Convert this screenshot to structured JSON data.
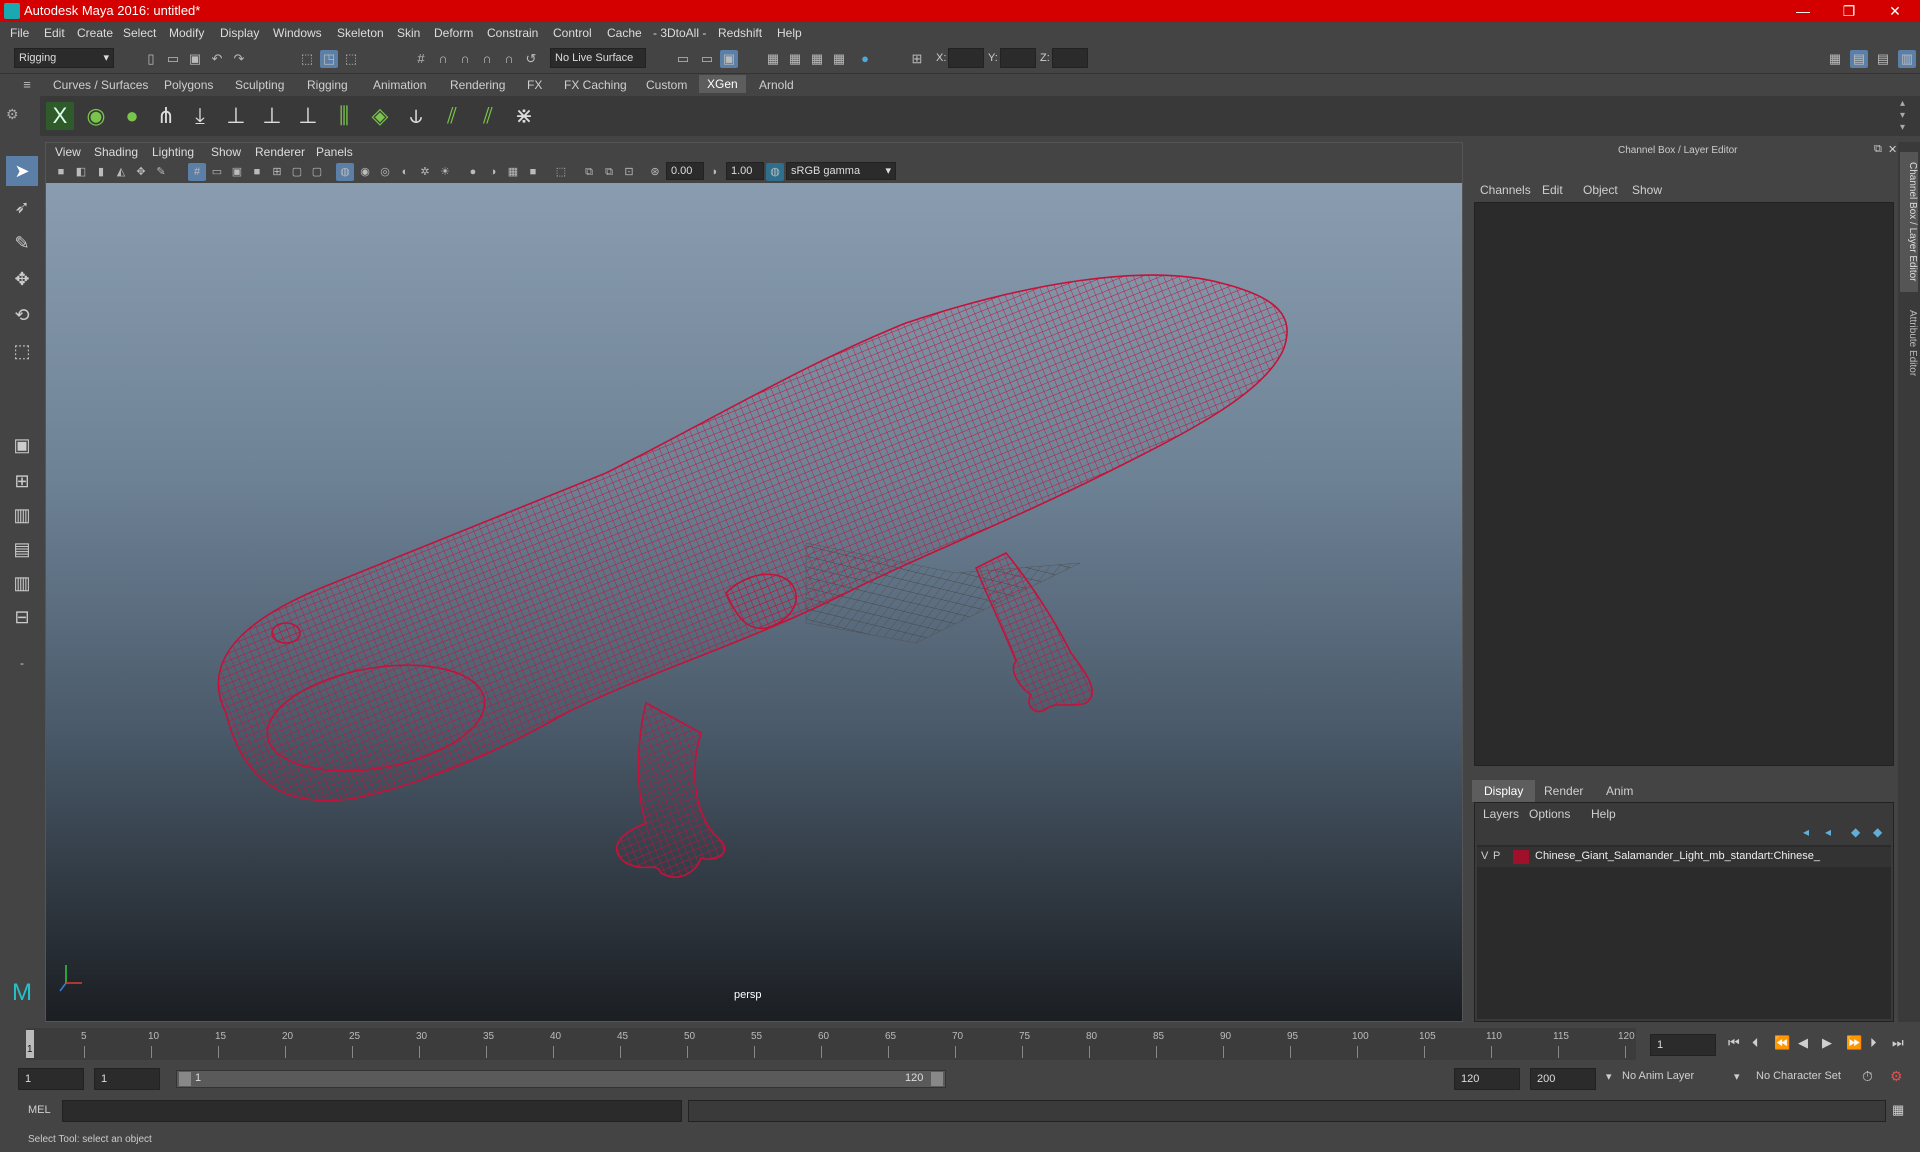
{
  "window": {
    "title": "Autodesk Maya 2016: untitled*",
    "minimize": "—",
    "restore": "❐",
    "close": "✕"
  },
  "menu": [
    "File",
    "Edit",
    "Create",
    "Select",
    "Modify",
    "Display",
    "Windows",
    "Skeleton",
    "Skin",
    "Deform",
    "Constrain",
    "Control",
    "Cache",
    "- 3DtoAll -",
    "Redshift",
    "Help"
  ],
  "statusline": {
    "menuset": "Rigging",
    "live_surface": "No Live Surface",
    "x_label": "X:",
    "y_label": "Y:",
    "z_label": "Z:"
  },
  "shelf_tabs": [
    "Curves / Surfaces",
    "Polygons",
    "Sculpting",
    "Rigging",
    "Animation",
    "Rendering",
    "FX",
    "FX Caching",
    "Custom",
    "XGen",
    "Arnold"
  ],
  "active_shelf": "XGen",
  "panel_menu": [
    "View",
    "Shading",
    "Lighting",
    "Show",
    "Renderer",
    "Panels"
  ],
  "panel_tools": {
    "exposure": "0.00",
    "gamma": "1.00",
    "color_space": "sRGB gamma"
  },
  "viewport": {
    "camera": "persp",
    "wire_color": "#c4123a"
  },
  "channel_box": {
    "title": "Channel Box / Layer Editor",
    "menus": [
      "Channels",
      "Edit",
      "Object",
      "Show"
    ],
    "layer_tabs": [
      "Display",
      "Render",
      "Anim"
    ],
    "active_layer_tab": "Display",
    "layer_menus": [
      "Layers",
      "Options",
      "Help"
    ],
    "layers": [
      {
        "v": "V",
        "p": "P",
        "color": "#a0102a",
        "name": "Chinese_Giant_Salamander_Light_mb_standart:Chinese_"
      }
    ]
  },
  "side_tabs": [
    "Channel Box / Layer Editor",
    "Attribute Editor"
  ],
  "timeline": {
    "ticks": [
      "5",
      "10",
      "15",
      "20",
      "25",
      "30",
      "35",
      "40",
      "45",
      "50",
      "55",
      "60",
      "65",
      "70",
      "75",
      "80",
      "85",
      "90",
      "95",
      "100",
      "105",
      "110",
      "115",
      "120"
    ],
    "start_marker": "1",
    "current_frame": "1"
  },
  "range": {
    "start": "1",
    "playback_start": "1",
    "slider_start": "1",
    "slider_end": "120",
    "playback_end": "120",
    "end": "200",
    "anim_layer": "No Anim Layer",
    "character_set": "No Character Set"
  },
  "command_line": {
    "label": "MEL"
  },
  "help_line": "Select Tool: select an object"
}
